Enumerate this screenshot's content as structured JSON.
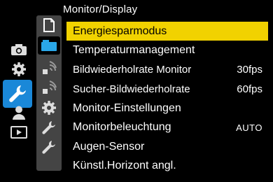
{
  "title": "Monitor/Display",
  "colors": {
    "selected_bg": "#f1d200",
    "tab_active": "#1a88d8",
    "sidebar": "#444444",
    "icon_blue": "#2aa7e8"
  },
  "left_tabs": [
    "camera-icon",
    "gear-icon",
    "wrench-icon",
    "person-icon",
    "play-icon"
  ],
  "sub_tabs": [
    "page-1-icon",
    "page-2-icon",
    "page-3-icon",
    "page-4-icon",
    "page-5-icon",
    "page-6-icon",
    "page-7-icon"
  ],
  "items": [
    {
      "label": "Energiesparmodus",
      "value": ""
    },
    {
      "label": "Temperaturmanagement",
      "value": ""
    },
    {
      "label": "Bildwiederholrate Monitor",
      "value": "30fps"
    },
    {
      "label": "Sucher-Bildwiederholrate",
      "value": "60fps"
    },
    {
      "label": "Monitor-Einstellungen",
      "value": ""
    },
    {
      "label": "Monitorbeleuchtung",
      "value": "AUTO"
    },
    {
      "label": "Augen-Sensor",
      "value": ""
    },
    {
      "label": "Künstl.Horizont angl.",
      "value": ""
    }
  ]
}
